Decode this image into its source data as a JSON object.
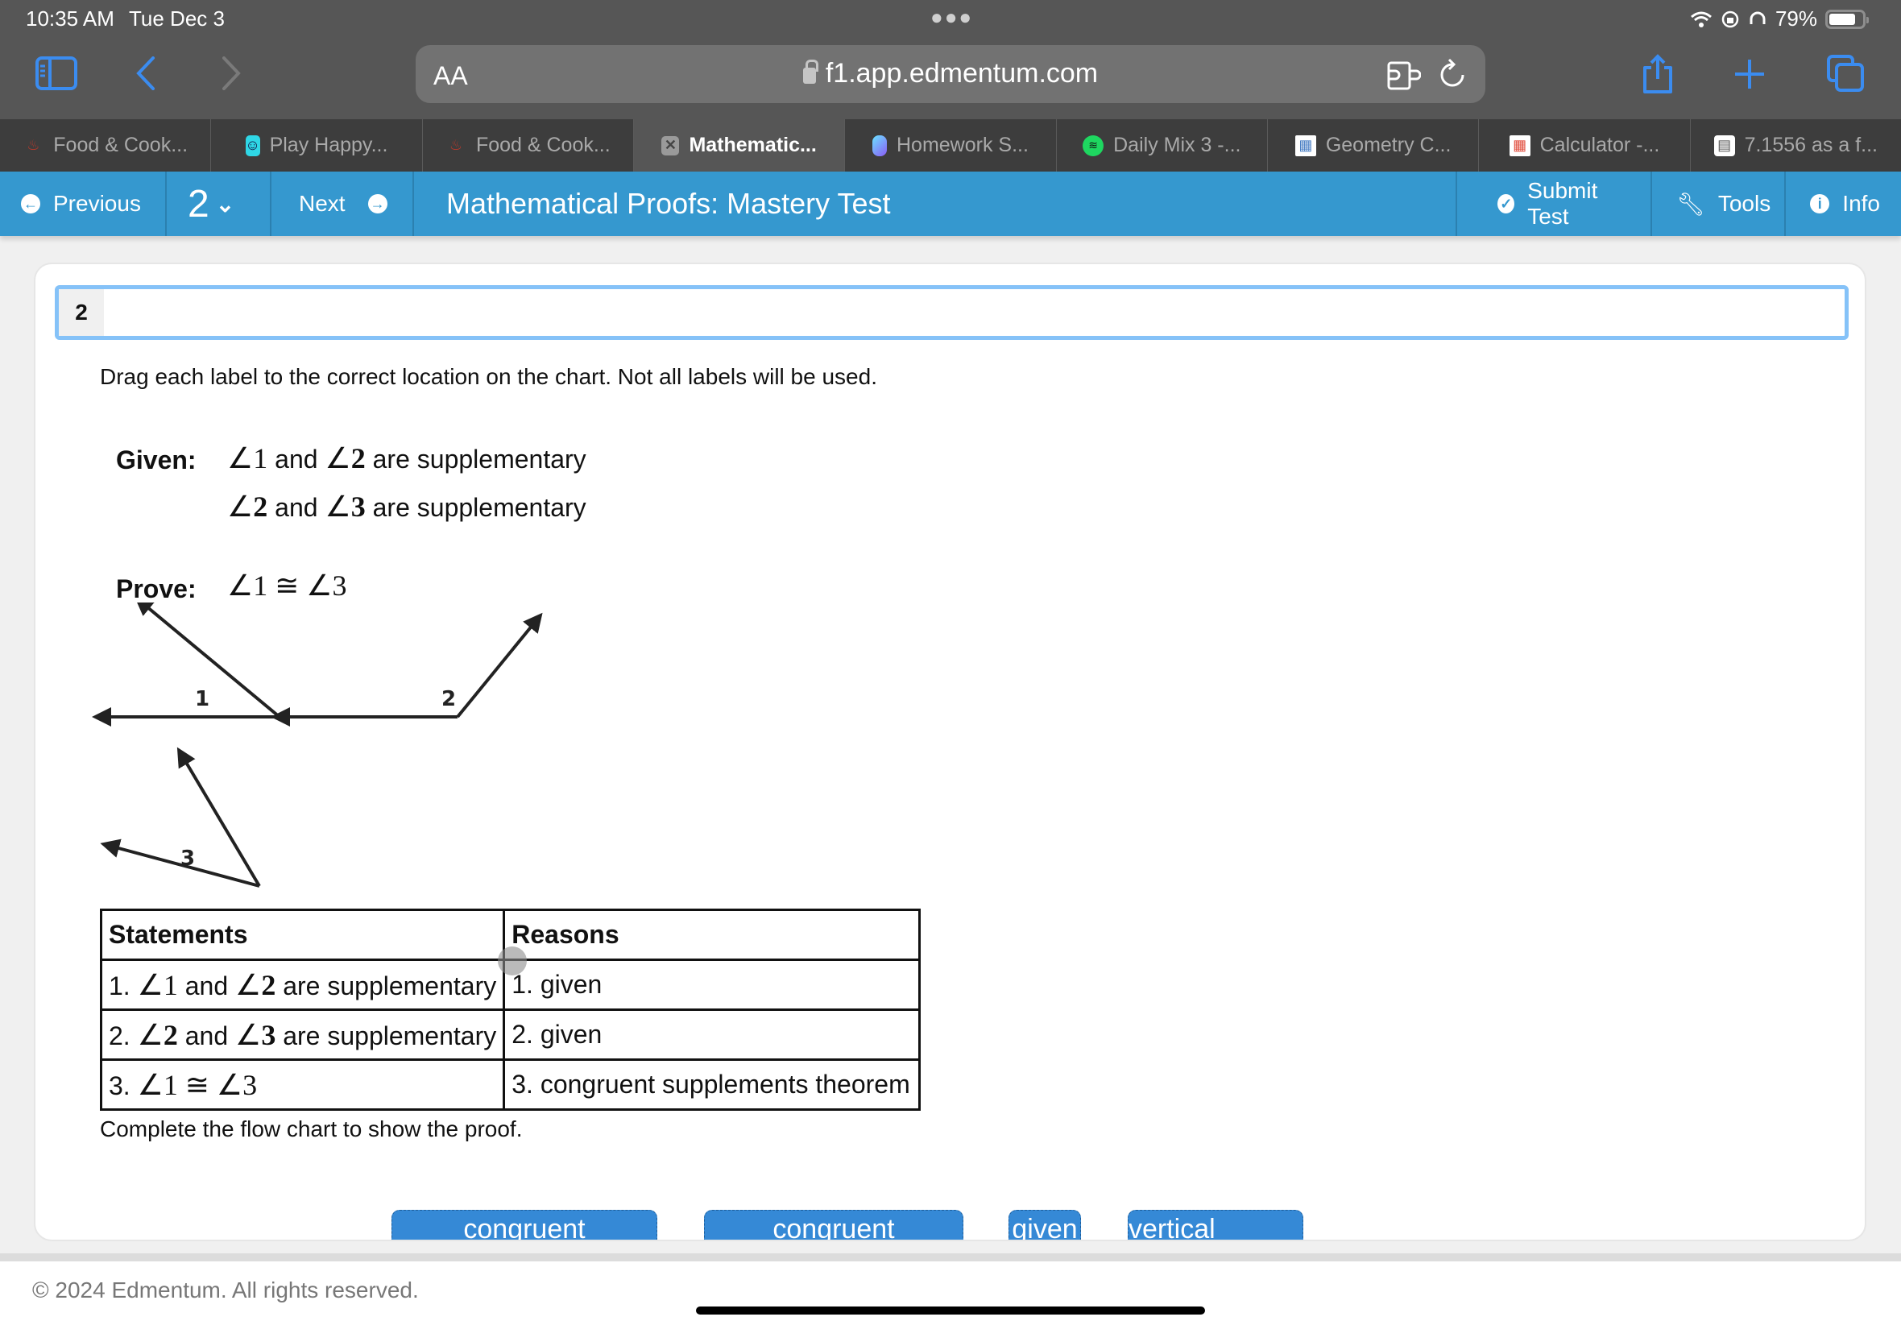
{
  "status_bar": {
    "time": "10:35 AM",
    "date": "Tue Dec 3",
    "battery": "79%",
    "battery_level": 0.79
  },
  "browser": {
    "text_size_label": "AA",
    "url": "f1.app.edmentum.com",
    "tabs": [
      {
        "label": "Food & Cook...",
        "icon": "food-favicon"
      },
      {
        "label": "Play Happy...",
        "icon": "cup-favicon"
      },
      {
        "label": "Food & Cook...",
        "icon": "food-favicon"
      },
      {
        "label": "Mathematic...",
        "icon": "close-icon",
        "active": true
      },
      {
        "label": "Homework S...",
        "icon": "crystal-favicon"
      },
      {
        "label": "Daily Mix 3 -...",
        "icon": "spotify-favicon"
      },
      {
        "label": "Geometry C...",
        "icon": "calculator-blue-favicon"
      },
      {
        "label": "Calculator -...",
        "icon": "calculator-red-favicon"
      },
      {
        "label": "7.1556 as a f...",
        "icon": "calculator-gray-favicon"
      }
    ]
  },
  "appbar": {
    "previous": "Previous",
    "question_number": "2",
    "next": "Next",
    "title": "Mathematical Proofs: Mastery Test",
    "submit": "Submit Test",
    "tools": "Tools",
    "info": "Info"
  },
  "question": {
    "number": "2",
    "instruction": "Drag each label to the correct location on the chart. Not all labels will be used.",
    "given_label": "Given:",
    "given": [
      {
        "a": "1",
        "b": "2",
        "text": "are supplementary"
      },
      {
        "a": "2",
        "b": "3",
        "text": "are supplementary"
      }
    ],
    "and_word": "and",
    "prove_label": "Prove:",
    "prove": {
      "a": "1",
      "b": "3",
      "symbol": "≅"
    },
    "figure_labels": [
      "1",
      "2",
      "3"
    ],
    "table": {
      "headers": [
        "Statements",
        "Reasons"
      ],
      "rows": [
        {
          "num": "1.",
          "a": "1",
          "b": "2",
          "text": "are supplementary",
          "reason": "1. given"
        },
        {
          "num": "2.",
          "a": "2",
          "b": "3",
          "text": "are supplementary",
          "reason": "2. given"
        },
        {
          "num": "3.",
          "a": "1",
          "b": "3",
          "symbol": "≅",
          "reason": "3. congruent supplements theorem"
        }
      ]
    },
    "complete_text": "Complete the flow chart to show the proof.",
    "drag_labels": [
      "congruent",
      "congruent",
      "given",
      "vertical angles"
    ]
  },
  "footer": {
    "copyright": "© 2024 Edmentum. All rights reserved."
  }
}
